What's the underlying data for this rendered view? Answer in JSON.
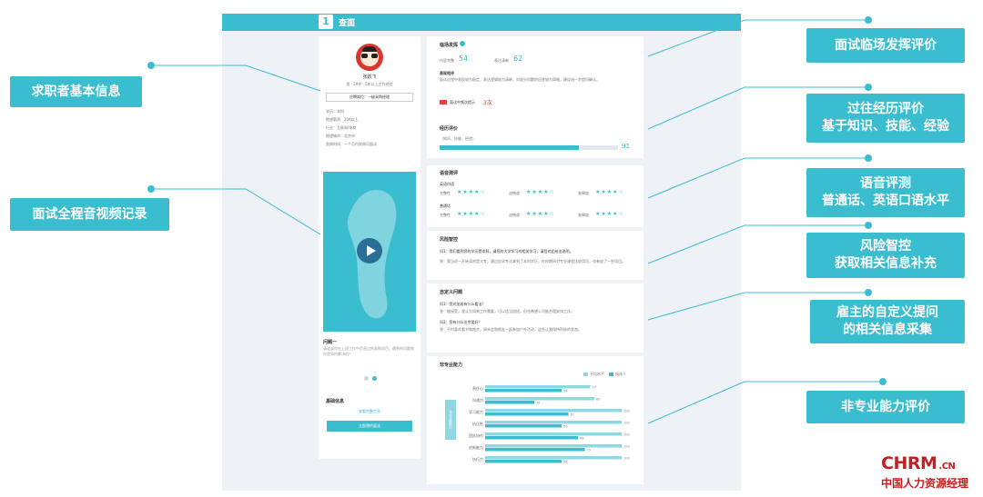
{
  "frame": {
    "badge": "1",
    "title": "查面"
  },
  "callouts_left": [
    {
      "id": "basic-info",
      "text": "求职者基本信息"
    },
    {
      "id": "video-record",
      "text": "面试全程音视频记录"
    }
  ],
  "callouts_right": [
    {
      "id": "performance",
      "line1": "面试临场发挥评价",
      "line2": ""
    },
    {
      "id": "experience",
      "line1": "过往经历评价",
      "line2": "基于知识、技能、经验"
    },
    {
      "id": "voice",
      "line1": "语音评测",
      "line2": "普通话、英语口语水平"
    },
    {
      "id": "risk",
      "line1": "风险智控",
      "line2": "获取相关信息补充"
    },
    {
      "id": "custom",
      "line1": "雇主的自定义提问",
      "line2": "的相关信息采集"
    },
    {
      "id": "nonpro",
      "line1": "非专业能力评价",
      "line2": ""
    }
  ],
  "profile": {
    "name": "张跃飞",
    "meta": "男 · 29岁 · 5年以上工作经验",
    "position_btn": "应聘岗位：一级采购经理",
    "fields": [
      "学历：本科",
      "期望薪资：20K以上",
      "行业：互联网/电商",
      "期望城市：北京市",
      "到岗时间：一个月内到岗可面试"
    ]
  },
  "video": {
    "question_title": "问题一",
    "question_text": "请谈谈你在上段工作中负责过的采购项目，遇到的问题和你是如何解决的？"
  },
  "basic_info_card": {
    "title": "基础信息",
    "link": "查看完整信息",
    "button": "立即预约面试"
  },
  "performance": {
    "title": "临场发挥",
    "score1_label": "内容完整",
    "score1_value": "54",
    "score2_label": "表达清晰",
    "score2_value": "62",
    "comment_title": "表现短评",
    "comment_text": "面试过程中表现较为稳定，表达逻辑较为清晰，对部分问题的回答较为简略，建议进一步提问确认。",
    "warning_label": "面试中频次提示",
    "warning_value": "3次"
  },
  "experience": {
    "title": "经历评价",
    "sub": "（知识、技能、经验）",
    "score": "91",
    "progress": 0.78
  },
  "voice": {
    "title": "语音测评",
    "groups": [
      {
        "name": "英语口语",
        "items": [
          "完整性",
          "流畅度",
          "准确度"
        ]
      },
      {
        "name": "普通话",
        "items": [
          "完整性",
          "流畅度",
          "准确度"
        ]
      }
    ],
    "stars": "★★★★☆"
  },
  "risk": {
    "title": "风险智控",
    "question": "问1：我们看到您的学历是本科，请您的大学学习的相关学习，请您对此给出说明。",
    "answer": "答：我当初一开始读的是大专，通过自学考试拿到了本科学历，在校期间对专业课程比较用功，也参加了一些项目。"
  },
  "custom": {
    "title": "自定义问题",
    "q1": "问1：您对加班有什么看法？",
    "a1": "答：能接受，我认为如果工作需要，可以适当加班，但也希望公司能合理安排工作。",
    "q2": "问2：您有什么业余爱好？",
    "a2": "答：平时喜欢看书和跑步，周末会和朋友一起参加户外活动，这些让我保持积极的状态。"
  },
  "nonpro": {
    "title": "非专业能力",
    "legend": [
      "平均水平",
      "候选人"
    ],
    "side_label": "非专业能力",
    "chart_data": {
      "type": "bar",
      "categories": [
        "责任心",
        "沟通力",
        "学习能力",
        "抗压性",
        "团队协作",
        "创新能力",
        "执行力"
      ],
      "series": [
        {
          "name": "平均水平",
          "values": [
            77,
            80,
            100,
            100,
            100,
            100,
            100
          ]
        },
        {
          "name": "候选人",
          "values": [
            56,
            36,
            61,
            56,
            68,
            73,
            56
          ]
        }
      ],
      "xlim": [
        0,
        100
      ]
    }
  },
  "logo": {
    "brand": "CHRM",
    "suffix": ".CN",
    "tagline": "中国人力资源经理"
  },
  "colors": {
    "accent": "#3bbdd0",
    "accent_light": "#8fd7e2",
    "warn": "#e0453b"
  }
}
